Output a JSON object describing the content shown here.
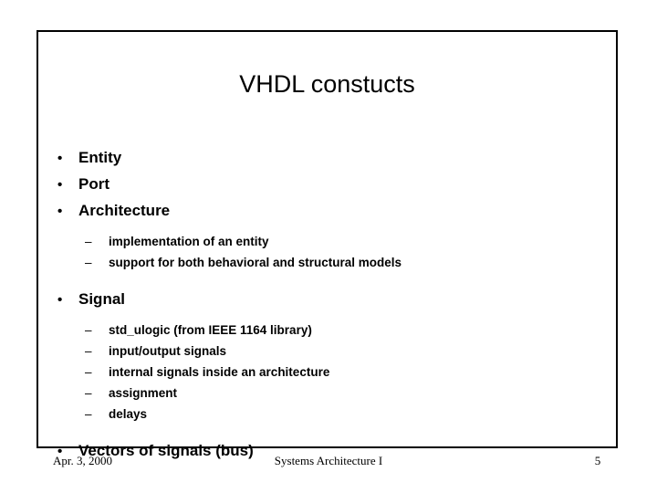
{
  "slide": {
    "title": "VHDL constucts",
    "border_color": "#000000",
    "background_color": "#ffffff",
    "text_color": "#000000",
    "bullet_marker": "•",
    "dash_marker": "–",
    "outline": [
      {
        "level": 1,
        "text": "Entity"
      },
      {
        "level": 1,
        "text": "Port"
      },
      {
        "level": 1,
        "text": "Architecture"
      },
      {
        "level": 2,
        "text": "implementation of an entity"
      },
      {
        "level": 2,
        "text": "support for both behavioral and structural models"
      },
      {
        "level": 1,
        "text": "Signal"
      },
      {
        "level": 2,
        "text": "std_ulogic (from IEEE 1164 library)"
      },
      {
        "level": 2,
        "text": "input/output signals"
      },
      {
        "level": 2,
        "text": "internal signals inside an architecture"
      },
      {
        "level": 2,
        "text": "assignment"
      },
      {
        "level": 2,
        "text": "delays"
      },
      {
        "level": 1,
        "text": "Vectors of signals (bus)"
      }
    ]
  },
  "footer": {
    "date": "Apr. 3, 2000",
    "course": "Systems Architecture I",
    "page_number": "5"
  }
}
